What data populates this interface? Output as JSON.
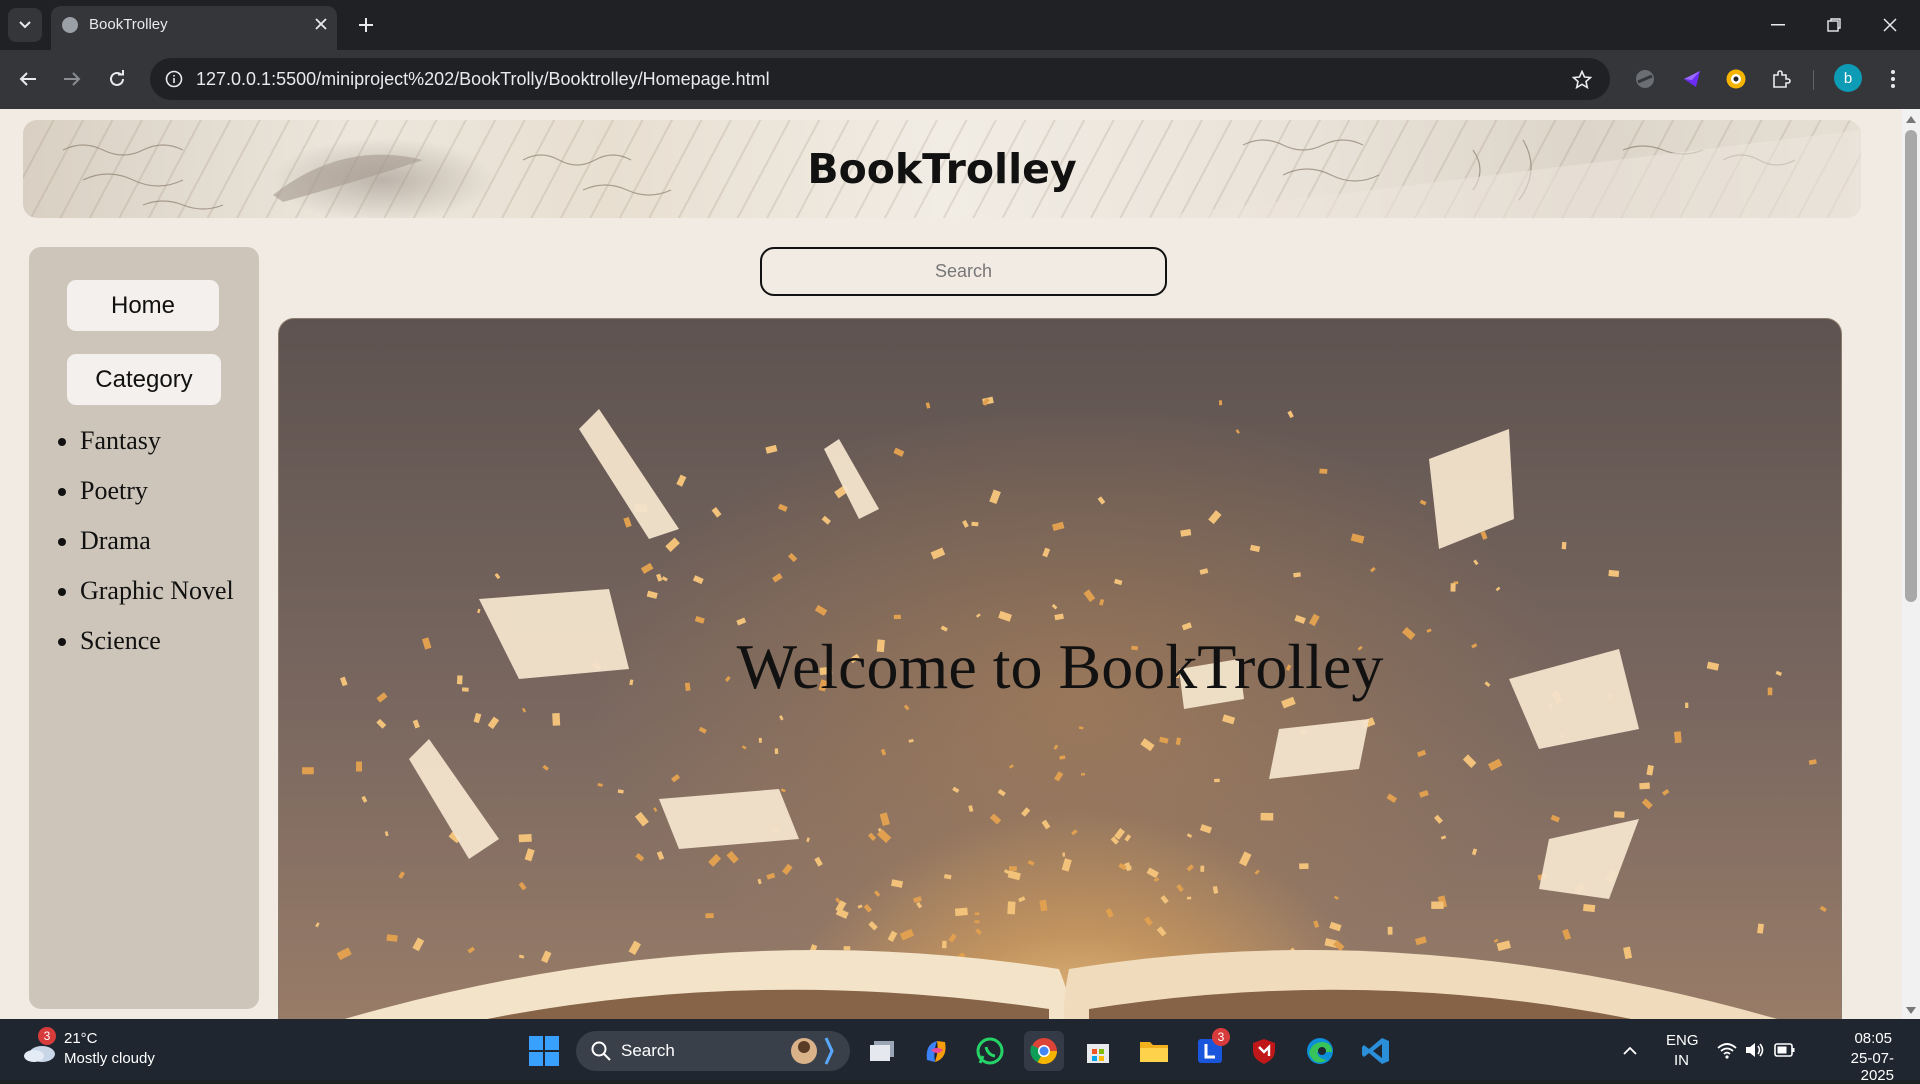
{
  "browser": {
    "tab_title": "BookTrolley",
    "url": "127.0.0.1:5500/miniproject%202/BookTrolly/Booktrolley/Homepage.html",
    "profile_initial": "b"
  },
  "page": {
    "banner_title": "BookTrolley",
    "nav": {
      "home_label": "Home",
      "category_label": "Category"
    },
    "categories": [
      "Fantasy",
      "Poetry",
      "Drama",
      "Graphic Novel",
      "Science"
    ],
    "search_placeholder": "Search",
    "hero_title": "Welcome to BookTrolley"
  },
  "taskbar": {
    "weather_badge": "3",
    "weather_temp": "21°C",
    "weather_desc": "Mostly cloudy",
    "search_label": "Search",
    "lexicon_badge": "3",
    "lang_line1": "ENG",
    "lang_line2": "IN",
    "time": "08:05",
    "date": "25-07-2025"
  },
  "icons": [
    "tab-list-icon",
    "globe-icon",
    "close-icon",
    "plus-icon",
    "minimize-icon",
    "restore-icon",
    "window-close-icon",
    "back-icon",
    "forward-icon",
    "reload-icon",
    "info-icon",
    "star-icon",
    "extension-icon",
    "menu-icon",
    "windows-icon",
    "search-icon",
    "wifi-icon",
    "volume-icon",
    "battery-icon"
  ],
  "colors": {
    "page_bg": "#f2ebe3",
    "sidebar_bg": "#cdc5b9",
    "chrome_bg": "#202124",
    "toolbar_bg": "#35363a",
    "taskbar_bg": "#1f2630"
  }
}
